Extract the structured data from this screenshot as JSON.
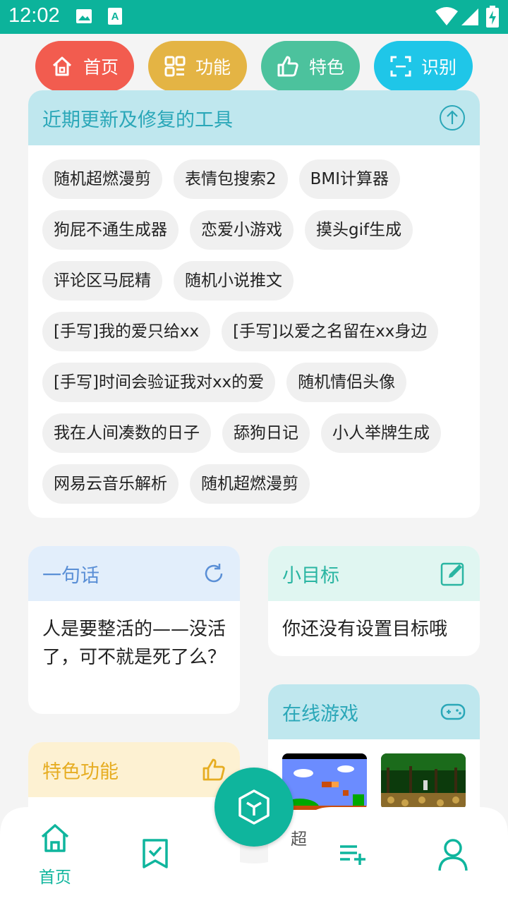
{
  "status_bar": {
    "time": "12:02"
  },
  "top_pills": [
    {
      "label": "首页",
      "color": "#f25c4f",
      "icon": "home-icon"
    },
    {
      "label": "功能",
      "color": "#e4b444",
      "icon": "grid-icon"
    },
    {
      "label": "特色",
      "color": "#4cc29d",
      "icon": "thumbs-up-icon"
    },
    {
      "label": "识别",
      "color": "#1fc6e8",
      "icon": "scan-icon"
    }
  ],
  "recent_tools": {
    "title": "近期更新及修复的工具",
    "tags": [
      "随机超燃漫剪",
      "表情包搜索2",
      "BMI计算器",
      "狗屁不通生成器",
      "恋爱小游戏",
      "摸头gif生成",
      "评论区马屁精",
      "随机小说推文",
      "[手写]我的爱只给xx",
      "[手写]以爱之名留在xx身边",
      "[手写]时间会验证我对xx的爱",
      "随机情侣头像",
      "我在人间凑数的日子",
      "舔狗日记",
      "小人举牌生成",
      "网易云音乐解析",
      "随机超燃漫剪"
    ]
  },
  "sentence_card": {
    "title": "一句话",
    "text": "人是要整活的——没活了，可不就是死了么？"
  },
  "goal_card": {
    "title": "小目标",
    "text": "你还没有设置目标哦"
  },
  "games_card": {
    "title": "在线游戏",
    "partial_label": "超"
  },
  "feature_card": {
    "title": "特色功能"
  },
  "bottom_nav": {
    "home_label": "首页"
  },
  "colors": {
    "accent": "#0cb39b",
    "teal_header": "#bfe7ee",
    "teal_text": "#2aa7b8"
  }
}
